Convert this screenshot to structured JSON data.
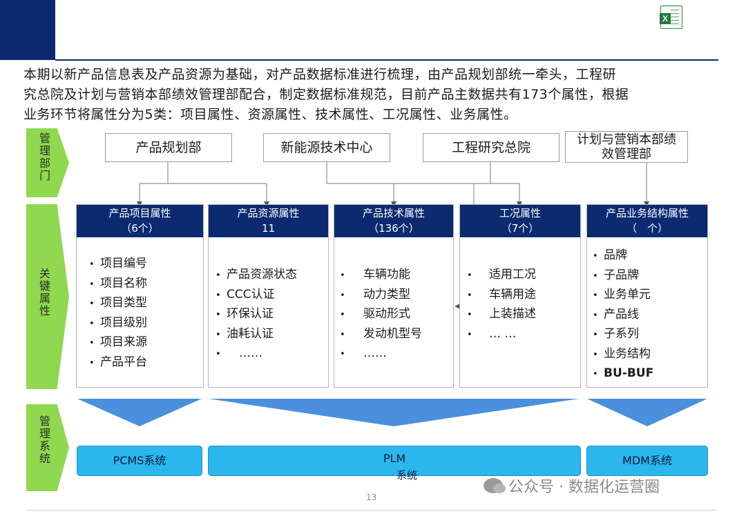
{
  "header": {
    "file_icon": "excel-file-icon",
    "intro_lines": [
      "本期以新产品信息表及产品资源为基础，对产品数据标准进行梳理，由产品规划部统一牵头，工程研",
      "究总院及计划与营销本部绩效管理部配合，制定数据标准规范，目前产品主数据共有173个属性，根据",
      "业务环节将属性分为5类：项目属性、资源属性、技术属性、工况属性、业务属性。"
    ]
  },
  "rows": {
    "management_dept": "管理部门",
    "key_attributes": "关键属性",
    "management_system": "管理系统"
  },
  "departments": [
    "产品规划部",
    "新能源技术中心",
    "工程研究总院",
    "计划与营销本部绩效管理部"
  ],
  "cards": [
    {
      "title": "产品项目属性",
      "count": "（6个）",
      "items": [
        "项目编号",
        "项目名称",
        "项目类型",
        "项目级别",
        "项目来源",
        "产品平台"
      ]
    },
    {
      "title": "产品资源属性",
      "count": "11",
      "items": [
        "产品资源状态",
        "CCC认证",
        "环保认证",
        "油耗认证",
        "……"
      ]
    },
    {
      "title": "产品技术属性",
      "count": "（136个）",
      "items": [
        "车辆功能",
        "动力类型",
        "驱动形式",
        "发动机型号",
        "……"
      ]
    },
    {
      "title": "工况属性",
      "count": "（7个）",
      "items": [
        "适用工况",
        "车辆用途",
        "上装描述",
        "… …"
      ]
    },
    {
      "title": "产品业务结构属性",
      "count": "（　个）",
      "items": [
        "品牌",
        "子品牌",
        "业务单元",
        "产品线",
        "子系列",
        "业务结构",
        "BU-BUF"
      ]
    }
  ],
  "systems": [
    "PCMS系统",
    "PLM",
    "系统",
    "MDM系统"
  ],
  "footer": {
    "page_number": "13",
    "watermark": "公众号 · 数据化运营圈"
  },
  "colors": {
    "navy": "#0b2a6f",
    "green_chevron": "#8fd84f",
    "system_blue": "#29b7ee",
    "funnel_blue": "#4a90dc"
  }
}
